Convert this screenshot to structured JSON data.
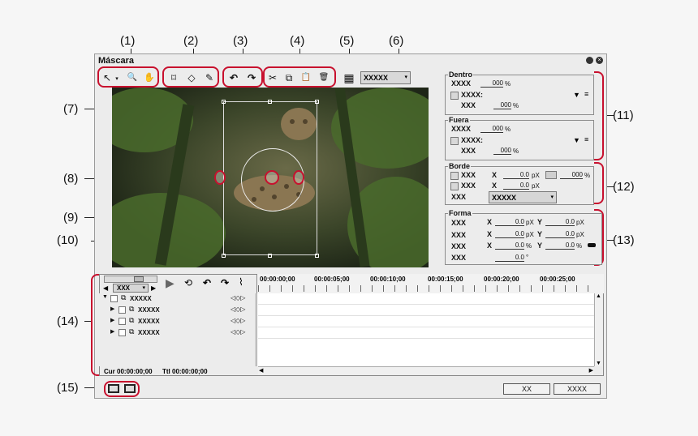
{
  "callouts": {
    "c1": "(1)",
    "c2": "(2)",
    "c3": "(3)",
    "c4": "(4)",
    "c5": "(5)",
    "c6": "(6)",
    "c7": "(7)",
    "c8": "(8)",
    "c9": "(9)",
    "c10": "(10)",
    "c11": "(11)",
    "c12": "(12)",
    "c13": "(13)",
    "c14": "(14)",
    "c15": "(15)"
  },
  "window": {
    "title": "Máscara"
  },
  "toolbar": {
    "select_icon": "↖",
    "select_arrow": "▾",
    "zoom_icon": "🔍",
    "hand_icon": "✋",
    "rect_icon": "⌑",
    "ellipse_icon": "◇",
    "pen_icon": "✎",
    "undo_icon": "↶",
    "redo_icon": "↷",
    "cut_icon": "✂",
    "copy_icon": "⧉",
    "paste_icon": "📋",
    "delete_icon": "🗑",
    "grid_icon": "▦",
    "dropdown_value": "XXXXX"
  },
  "dentro": {
    "title": "Dentro",
    "row1_label": "XXXX",
    "row1_value": "000",
    "row1_unit": "%",
    "row2_label": "XXXX:",
    "row3_label": "XXX",
    "row3_value": "000",
    "row3_unit": "%"
  },
  "fuera": {
    "title": "Fuera",
    "row1_label": "XXXX",
    "row1_value": "000",
    "row1_unit": "%",
    "row2_label": "XXXX:",
    "row3_label": "XXX",
    "row3_value": "000",
    "row3_unit": "%"
  },
  "borde": {
    "title": "Borde",
    "r1_label": "XXX",
    "r1_x": "X",
    "r1_value": "0.0",
    "r1_unit": "pX",
    "r1_pct": "000",
    "r1_pct_unit": "%",
    "r2_label": "XXX",
    "r2_x": "X",
    "r2_value": "0.0",
    "r2_unit": "pX",
    "r3_label": "XXX",
    "r3_select": "XXXXX"
  },
  "forma": {
    "title": "Forma",
    "r1_label": "XXX",
    "r1_x": "X",
    "r1_xv": "0.0",
    "r1_xu": "pX",
    "r1_y": "Y",
    "r1_yv": "0.0",
    "r1_yu": "pX",
    "r2_label": "XXX",
    "r2_x": "X",
    "r2_xv": "0.0",
    "r2_xu": "pX",
    "r2_y": "Y",
    "r2_yv": "0.0",
    "r2_yu": "pX",
    "r3_label": "XXX",
    "r3_x": "X",
    "r3_xv": "0.0",
    "r3_xu": "%",
    "r3_y": "Y",
    "r3_yv": "0.0",
    "r3_yu": "%",
    "r4_label": "XXX",
    "r4_v": "0.0",
    "r4_u": "°"
  },
  "timeline": {
    "zoom_select": "XXX",
    "ruler": [
      "00:00:00;00",
      "00:00:05;00",
      "00:00:10;00",
      "00:00:15;00",
      "00:00:20;00",
      "00:00:25;00"
    ],
    "tracks": [
      "XXXXX",
      "XXXXX",
      "XXXXX",
      "XXXXX"
    ],
    "cur": "Cur 00:00:00;00",
    "ttl": "Ttl 00:00:00;00"
  },
  "buttons": {
    "ok": "XX",
    "cancel": "XXXX"
  }
}
